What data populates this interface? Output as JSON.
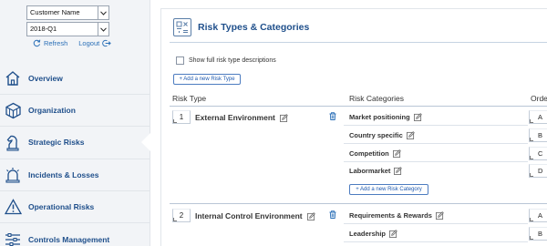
{
  "sidebar": {
    "customer_select": "Customer Name",
    "period_select": "2018-Q1",
    "refresh_label": "Refresh",
    "logout_label": "Logout",
    "items": [
      {
        "label": "Overview",
        "icon": "home-icon"
      },
      {
        "label": "Organization",
        "icon": "cube-icon"
      },
      {
        "label": "Strategic Risks",
        "icon": "chess-knight-icon"
      },
      {
        "label": "Incidents & Losses",
        "icon": "alarm-light-icon"
      },
      {
        "label": "Operational Risks",
        "icon": "warning-triangle-icon"
      },
      {
        "label": "Controls Management",
        "icon": "sliders-icon"
      }
    ]
  },
  "main": {
    "title": "Risk Types & Categories",
    "show_descriptions_label": "Show full risk type descriptions",
    "add_risk_type_label": "+ Add a new Risk Type",
    "columns": [
      "Risk Type",
      "Risk Categories",
      "Orde"
    ],
    "risk_types": [
      {
        "number": "1",
        "name": "External Environment",
        "categories": [
          {
            "name": "Market positioning",
            "order": "A"
          },
          {
            "name": "Country specific",
            "order": "B"
          },
          {
            "name": "Competition",
            "order": "C"
          },
          {
            "name": "Labormarket",
            "order": "D"
          }
        ],
        "add_category_label": "+ Add a new Risk Category"
      },
      {
        "number": "2",
        "name": "Internal Control Environment",
        "categories": [
          {
            "name": "Requirements & Rewards",
            "order": "A"
          },
          {
            "name": "Leadership",
            "order": "B"
          }
        ]
      }
    ]
  },
  "colors": {
    "accent": "#1f4f8b",
    "link": "#2a6fb7",
    "sidebar_bg": "#f2f4f7"
  }
}
